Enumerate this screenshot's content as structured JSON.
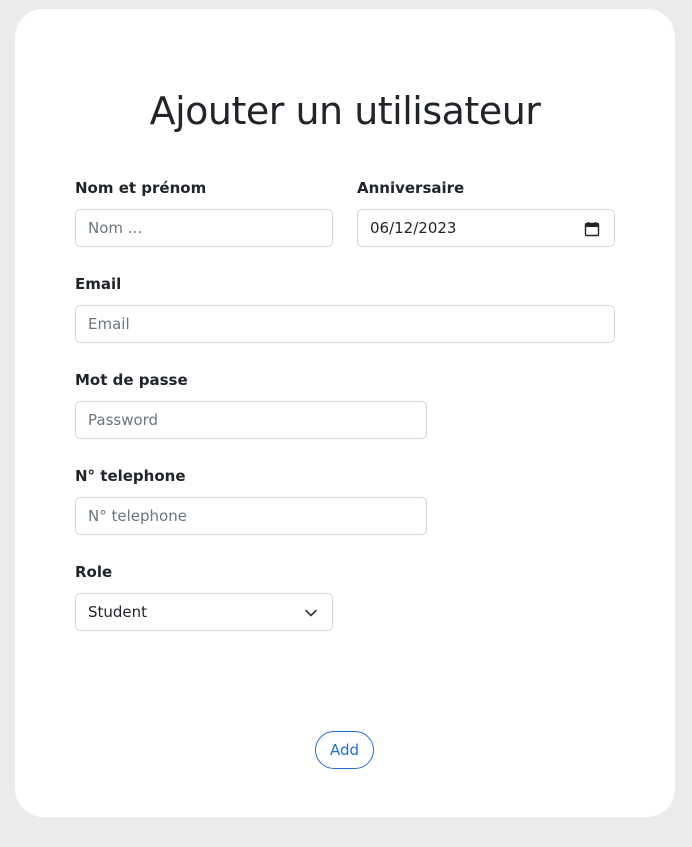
{
  "form": {
    "title": "Ajouter un utilisateur",
    "name": {
      "label": "Nom et prénom",
      "placeholder": "Nom ..."
    },
    "birthday": {
      "label": "Anniversaire",
      "value": "06/12/2023",
      "icon": "calendar-icon"
    },
    "email": {
      "label": "Email",
      "placeholder": "Email"
    },
    "password": {
      "label": "Mot de passe",
      "placeholder": "Password"
    },
    "phone": {
      "label": "N° telephone",
      "placeholder": "N° telephone"
    },
    "role": {
      "label": "Role",
      "selected": "Student",
      "icon": "chevron-down-icon"
    },
    "submit_label": "Add"
  },
  "colors": {
    "page_background": "#ebebec",
    "card_background": "#ffffff",
    "accent": "#1f6fd1",
    "input_border": "#ced4da",
    "placeholder": "#6c757d"
  }
}
